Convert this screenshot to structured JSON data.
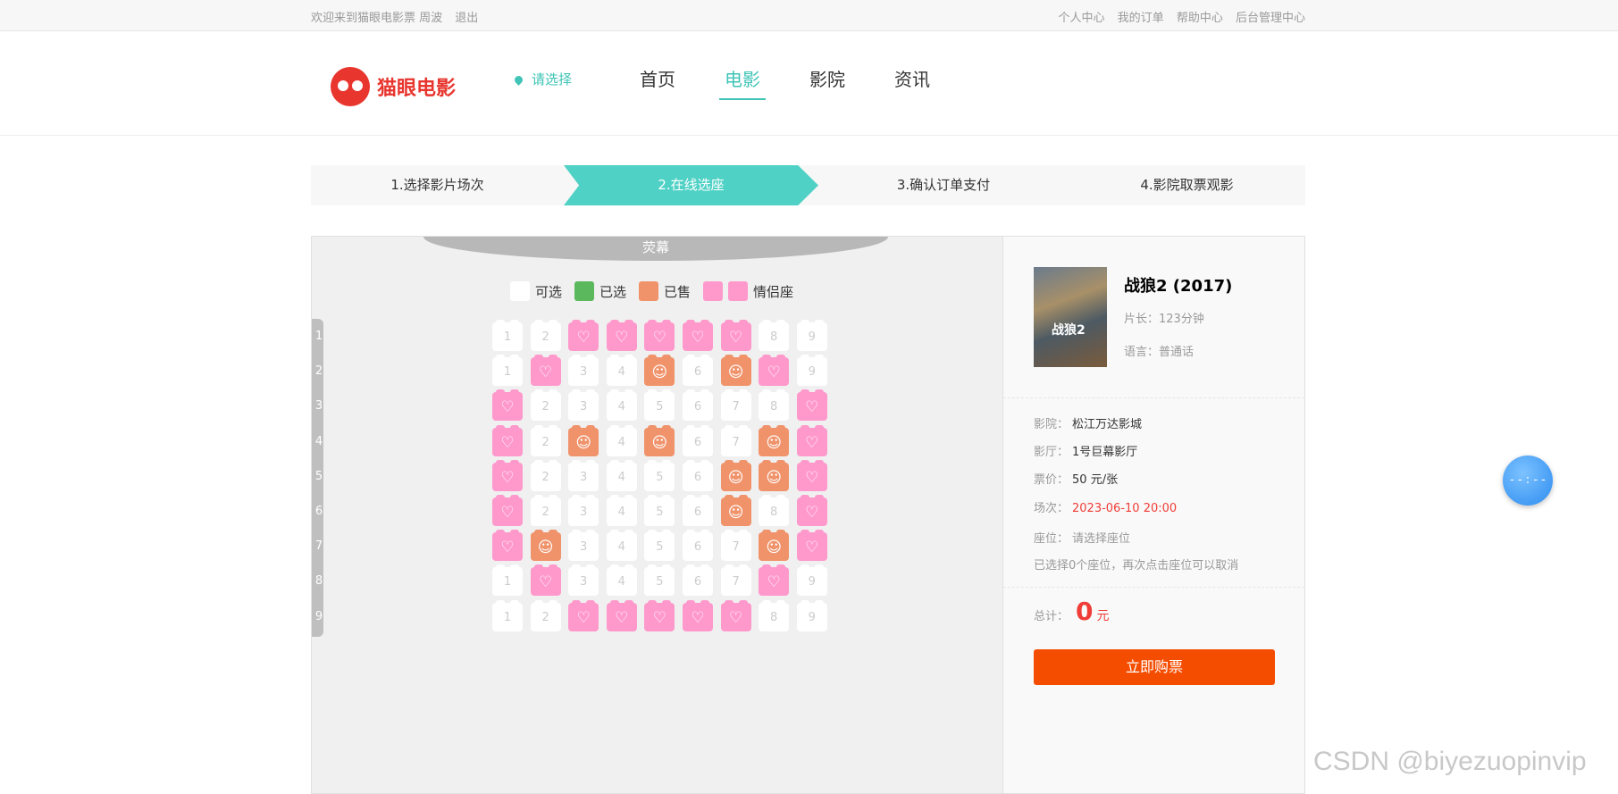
{
  "topbar": {
    "welcome": "欢迎来到猫眼电影票 周波",
    "logout": "退出",
    "links": [
      "个人中心",
      "我的订单",
      "帮助中心",
      "后台管理中心"
    ]
  },
  "header": {
    "logo_text": "猫眼电影",
    "city": "请选择",
    "nav": [
      "首页",
      "电影",
      "影院",
      "资讯"
    ],
    "active_nav": "电影"
  },
  "steps": [
    "1.选择影片场次",
    "2.在线选座",
    "3.确认订单支付",
    "4.影院取票观影"
  ],
  "seatmap": {
    "screen": "荧幕",
    "legend": {
      "available": "可选",
      "selected": "已选",
      "sold": "已售",
      "couple": "情侣座"
    },
    "rows": [
      [
        "a",
        "a",
        "c",
        "c",
        "c",
        "c",
        "c",
        "a",
        "a"
      ],
      [
        "a",
        "c",
        "a",
        "a",
        "s",
        "a",
        "s",
        "c",
        "a"
      ],
      [
        "c",
        "a",
        "a",
        "a",
        "a",
        "a",
        "a",
        "a",
        "c"
      ],
      [
        "c",
        "a",
        "s",
        "a",
        "s",
        "a",
        "a",
        "s",
        "c"
      ],
      [
        "c",
        "a",
        "a",
        "a",
        "a",
        "a",
        "s",
        "s",
        "c"
      ],
      [
        "c",
        "a",
        "a",
        "a",
        "a",
        "a",
        "s",
        "a",
        "c"
      ],
      [
        "c",
        "s",
        "a",
        "a",
        "a",
        "a",
        "a",
        "s",
        "c"
      ],
      [
        "a",
        "c",
        "a",
        "a",
        "a",
        "a",
        "a",
        "c",
        "a"
      ],
      [
        "a",
        "a",
        "c",
        "c",
        "c",
        "c",
        "c",
        "a",
        "a"
      ]
    ],
    "row_labels": [
      "1",
      "2",
      "3",
      "4",
      "5",
      "6",
      "7",
      "8",
      "9"
    ],
    "seat_numbers": [
      "1",
      "2",
      "3",
      "4",
      "5",
      "6",
      "7",
      "8",
      "9"
    ]
  },
  "movie": {
    "title": "战狼2 (2017)",
    "duration": "片长：123分钟",
    "language": "语言：普通话",
    "poster_text": "战狼2",
    "cinema_label": "影院：",
    "cinema": "松江万达影城",
    "hall_label": "影厅：",
    "hall": "1号巨幕影厅",
    "price_label": "票价：",
    "price": "50 元/张",
    "time_label": "场次：",
    "time": "2023-06-10 20:00",
    "seat_label": "座位：",
    "seat": "请选择座位",
    "hint": "已选择0个座位，再次点击座位可以取消",
    "total_label": "总计：",
    "total": "0",
    "total_unit": "元",
    "buy": "立即购票"
  },
  "float_button": "- - : - -",
  "watermark": "CSDN @biyezuopinvip"
}
